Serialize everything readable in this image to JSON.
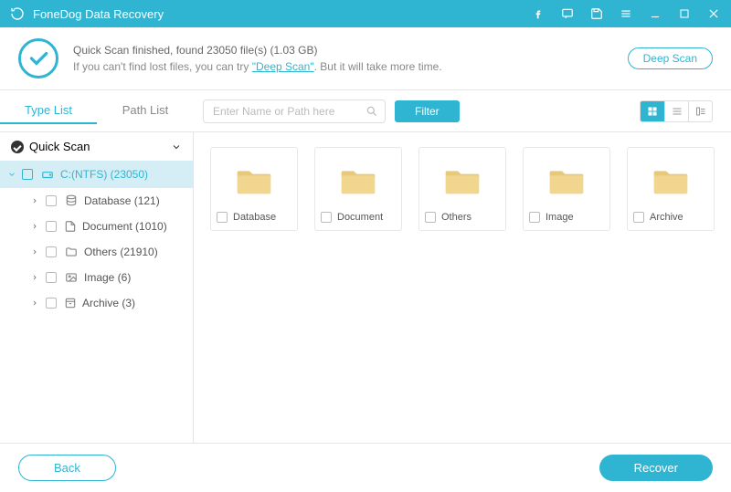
{
  "titlebar": {
    "title": "FoneDog Data Recovery"
  },
  "summary": {
    "line1": "Quick Scan finished, found 23050 file(s) (1.03 GB)",
    "hint_prefix": "If you can't find lost files, you can try ",
    "deep_link": "\"Deep Scan\"",
    "hint_suffix": ". But it will take more time.",
    "deep_scan_btn": "Deep Scan"
  },
  "tabs": {
    "type_list": "Type List",
    "path_list": "Path List"
  },
  "search": {
    "placeholder": "Enter Name or Path here"
  },
  "filter_btn": "Filter",
  "tree": {
    "root": "Quick Scan",
    "drive": "C:(NTFS) (23050)",
    "children": [
      {
        "label": "Database (121)",
        "icon": "database"
      },
      {
        "label": "Document (1010)",
        "icon": "document"
      },
      {
        "label": "Others (21910)",
        "icon": "folder"
      },
      {
        "label": "Image (6)",
        "icon": "image"
      },
      {
        "label": "Archive (3)",
        "icon": "archive"
      }
    ]
  },
  "folders": [
    {
      "name": "Database"
    },
    {
      "name": "Document"
    },
    {
      "name": "Others"
    },
    {
      "name": "Image"
    },
    {
      "name": "Archive"
    }
  ],
  "footer": {
    "back": "Back",
    "recover": "Recover"
  }
}
